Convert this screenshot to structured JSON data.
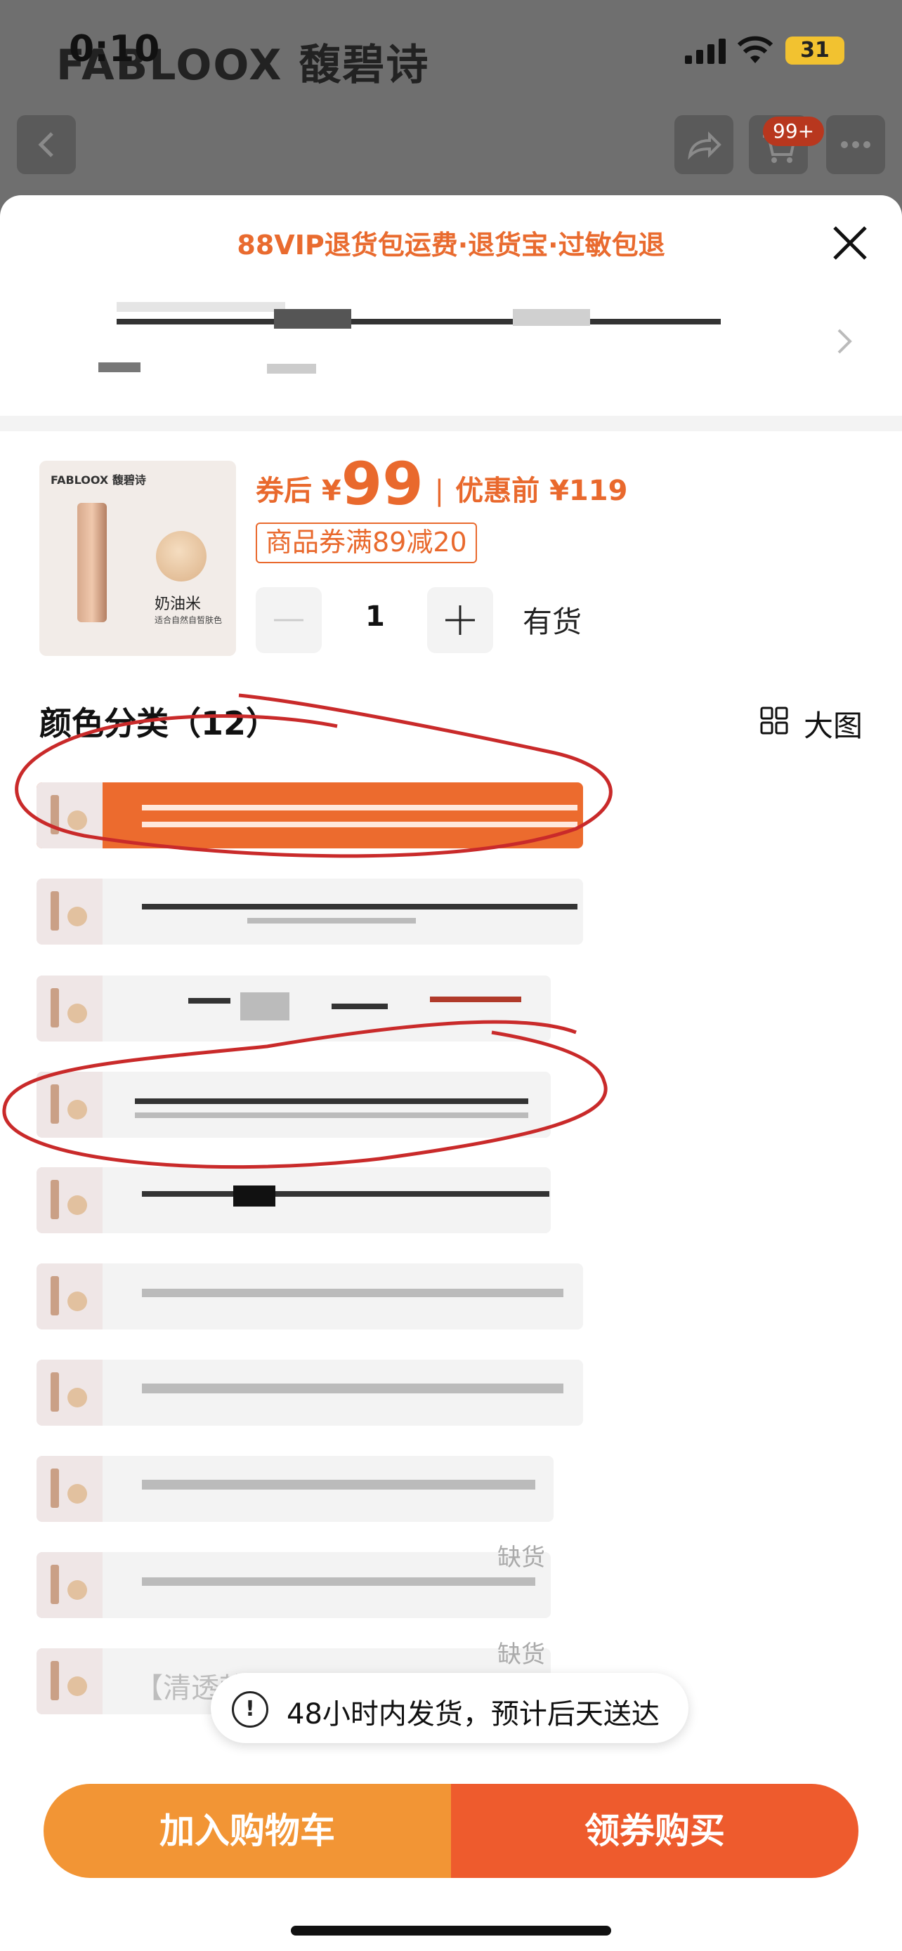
{
  "status": {
    "time": "0:10",
    "battery": "31"
  },
  "header": {
    "brand": "FABLOOX 馥碧诗",
    "cart_badge": "99+"
  },
  "promo": "88VIP退货包运费·退货宝·过敏包退",
  "product": {
    "thumb_logo": "FABLOOX 馥碧诗",
    "thumb_shade": "奶油米",
    "thumb_desc": "适合自然自皙肤色",
    "price_prefix": "券后 ¥",
    "price": "99",
    "orig_prefix": "优惠前 ¥",
    "orig_price": "119",
    "coupon": "商品券满89减20",
    "quantity": "1",
    "stock": "有货"
  },
  "section": {
    "title": "颜色分类（12）",
    "big_view": "大图"
  },
  "options": [
    {
      "label": "",
      "selected": true
    },
    {
      "label": ""
    },
    {
      "label": ""
    },
    {
      "label": ""
    },
    {
      "label": ""
    },
    {
      "label": ""
    },
    {
      "label": ""
    },
    {
      "label": ""
    },
    {
      "label": "",
      "status": "缺货"
    },
    {
      "label": "【清透款】奶油米色（02）",
      "status": "缺货"
    }
  ],
  "toast": {
    "icon": "!",
    "text": "48小时内发货，预计后天送达"
  },
  "actions": {
    "add_to_cart": "加入购物车",
    "buy": "领券购买"
  }
}
